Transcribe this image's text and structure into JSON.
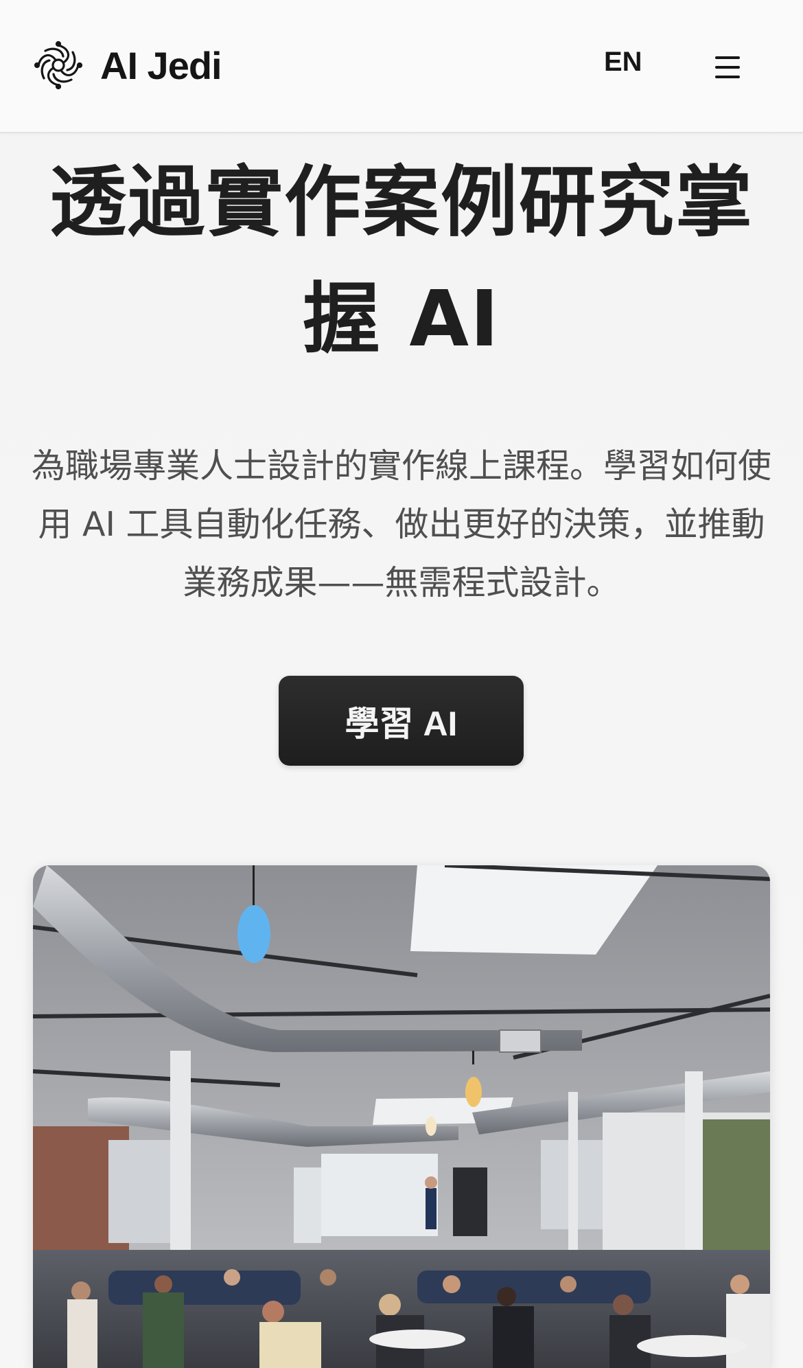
{
  "header": {
    "brand": "AI Jedi",
    "language": "EN",
    "logo_icon": "swirl-logo-icon",
    "menu_icon": "hamburger-menu-icon"
  },
  "hero": {
    "title": "透過實作案例研究掌握 AI",
    "subtitle": " 為職場專業人士設計的實作線上課程。學習如何使用 AI 工具自動化任務、做出更好的決策，並推動業務成果——無需程式設計。",
    "cta_label": "學習 AI"
  },
  "photo": {
    "subject": "classroom-event-photo"
  },
  "colors": {
    "background": "#f5f5f5",
    "header": "#fafafa",
    "button": "#252525",
    "button_text": "#f4f4f4",
    "title": "#1f1f1f",
    "subtitle": "#4f4f4f"
  }
}
